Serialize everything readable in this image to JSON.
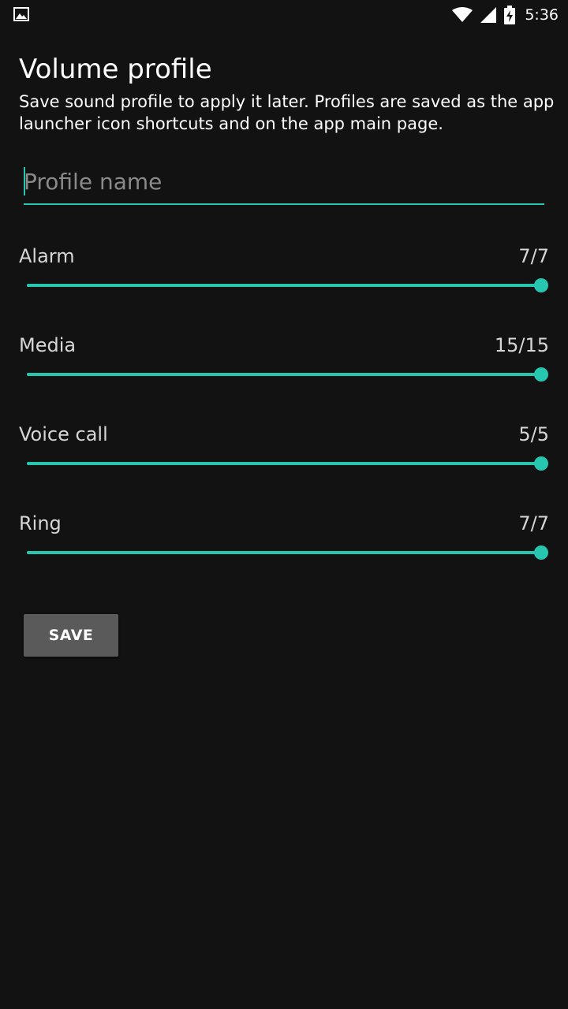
{
  "status_bar": {
    "time": "5:36",
    "icons": [
      "image-notification-icon",
      "wifi-icon",
      "cell-signal-icon",
      "battery-charging-icon"
    ]
  },
  "header": {
    "title": "Volume profile",
    "description": "Save sound profile to apply it later. Profiles are saved as the app launcher icon shortcuts and on the app main page."
  },
  "profile_name": {
    "value": "",
    "placeholder": "Profile name"
  },
  "volumes": [
    {
      "label": "Alarm",
      "display": "7/7",
      "level": 7,
      "max": 7
    },
    {
      "label": "Media",
      "display": "15/15",
      "level": 15,
      "max": 15
    },
    {
      "label": "Voice call",
      "display": "5/5",
      "level": 5,
      "max": 5
    },
    {
      "label": "Ring",
      "display": "7/7",
      "level": 7,
      "max": 7
    }
  ],
  "save_label": "SAVE",
  "colors": {
    "background": "#121212",
    "accent": "#26c6b0",
    "button": "#5a5a5a",
    "label": "#d6d6d6"
  }
}
